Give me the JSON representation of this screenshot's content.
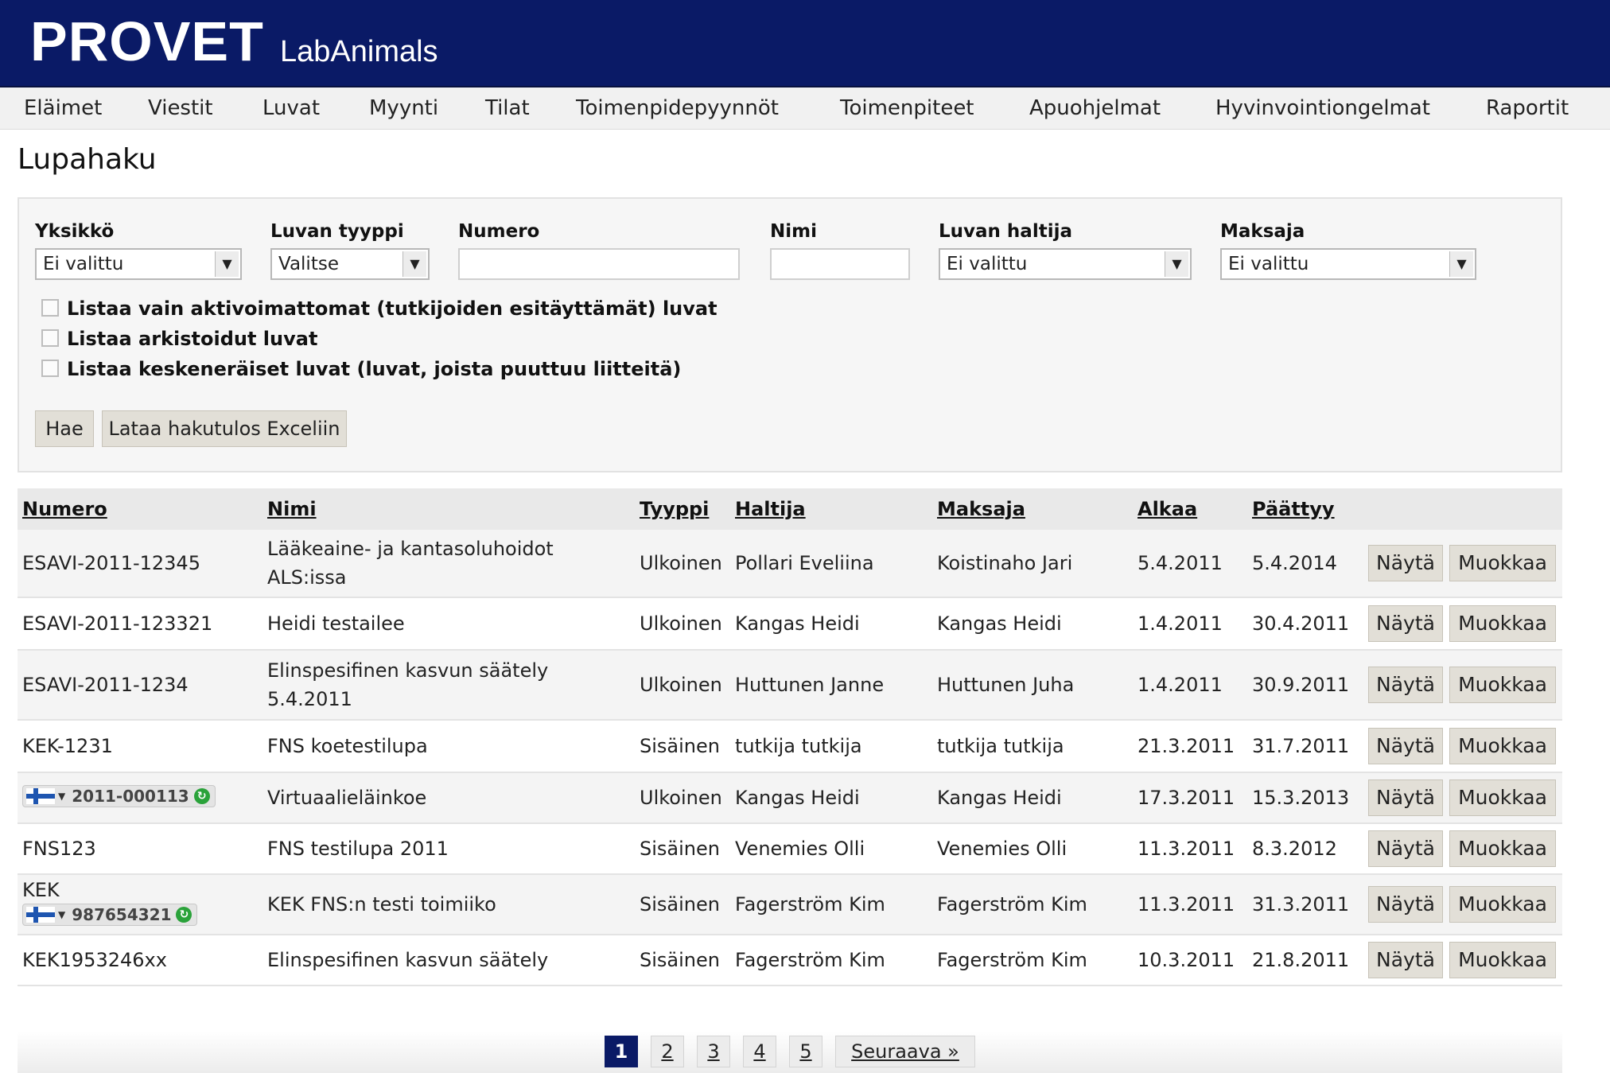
{
  "header": {
    "brand": "PROVET",
    "product": "LabAnimals"
  },
  "nav": [
    "Eläimet",
    "Viestit",
    "Luvat",
    "Myynti",
    "Tilat",
    "Toimenpidepyynnöt",
    "Toimenpiteet",
    "Apuohjelmat",
    "Hyvinvointiongelmat",
    "Raportit"
  ],
  "page_title": "Lupahaku",
  "filters": {
    "yksikko": {
      "label": "Yksikkö",
      "value": "Ei valittu"
    },
    "tyyppi": {
      "label": "Luvan tyyppi",
      "value": "Valitse"
    },
    "numero": {
      "label": "Numero",
      "value": ""
    },
    "nimi": {
      "label": "Nimi",
      "value": ""
    },
    "haltija": {
      "label": "Luvan haltija",
      "value": "Ei valittu"
    },
    "maksaja": {
      "label": "Maksaja",
      "value": "Ei valittu"
    }
  },
  "checkboxes": [
    "Listaa vain aktivoimattomat (tutkijoiden esitäyttämät) luvat",
    "Listaa arkistoidut luvat",
    "Listaa keskeneräiset luvat (luvat, joista puuttuu liitteitä)"
  ],
  "buttons": {
    "search": "Hae",
    "excel": "Lataa hakutulos Exceliin"
  },
  "table": {
    "headers": {
      "numero": "Numero",
      "nimi": "Nimi",
      "tyyppi": "Tyyppi",
      "haltija": "Haltija",
      "maksaja": "Maksaja",
      "alkaa": "Alkaa",
      "paattyy": "Päättyy"
    },
    "rows": [
      {
        "numero": "ESAVI-2011-12345",
        "tag": "",
        "nimi": "Lääkeaine- ja kantasoluhoidot ALS:issa",
        "tyyppi": "Ulkoinen",
        "haltija": "Pollari Eveliina",
        "maksaja": "Koistinaho Jari",
        "alkaa": "5.4.2011",
        "paattyy": "5.4.2014"
      },
      {
        "numero": "ESAVI-2011-123321",
        "tag": "",
        "nimi": "Heidi testailee",
        "tyyppi": "Ulkoinen",
        "haltija": "Kangas Heidi",
        "maksaja": "Kangas Heidi",
        "alkaa": "1.4.2011",
        "paattyy": "30.4.2011"
      },
      {
        "numero": "ESAVI-2011-1234",
        "tag": "",
        "nimi": "Elinspesifinen kasvun säätely 5.4.2011",
        "tyyppi": "Ulkoinen",
        "haltija": "Huttunen Janne",
        "maksaja": "Huttunen Juha",
        "alkaa": "1.4.2011",
        "paattyy": "30.9.2011"
      },
      {
        "numero": "KEK-1231",
        "tag": "",
        "nimi": "FNS koetestilupa",
        "tyyppi": "Sisäinen",
        "haltija": "tutkija tutkija",
        "maksaja": "tutkija tutkija",
        "alkaa": "21.3.2011",
        "paattyy": "31.7.2011"
      },
      {
        "numero": "",
        "tag": "2011-000113",
        "nimi": "Virtuaalieläinkoe",
        "tyyppi": "Ulkoinen",
        "haltija": "Kangas Heidi",
        "maksaja": "Kangas Heidi",
        "alkaa": "17.3.2011",
        "paattyy": "15.3.2013"
      },
      {
        "numero": "FNS123",
        "tag": "",
        "nimi": "FNS testilupa 2011",
        "tyyppi": "Sisäinen",
        "haltija": "Venemies Olli",
        "maksaja": "Venemies Olli",
        "alkaa": "11.3.2011",
        "paattyy": "8.3.2012"
      },
      {
        "numero": "KEK",
        "tag": "987654321",
        "nimi": "KEK FNS:n testi toimiiko",
        "tyyppi": "Sisäinen",
        "haltija": "Fagerström Kim",
        "maksaja": "Fagerström Kim",
        "alkaa": "11.3.2011",
        "paattyy": "31.3.2011"
      },
      {
        "numero": "KEK1953246xx",
        "tag": "",
        "nimi": "Elinspesifinen kasvun säätely",
        "tyyppi": "Sisäinen",
        "haltija": "Fagerström Kim",
        "maksaja": "Fagerström Kim",
        "alkaa": "10.3.2011",
        "paattyy": "21.8.2011"
      }
    ],
    "row_buttons": {
      "show": "Näytä",
      "edit": "Muokkaa"
    }
  },
  "pagination": {
    "pages": [
      "1",
      "2",
      "3",
      "4",
      "5"
    ],
    "current": "1",
    "next": "Seuraava »"
  },
  "colors": {
    "header_bg": "#0a1a66",
    "flag_blue": "#1e55b0",
    "ok_green": "#2aa23a"
  }
}
